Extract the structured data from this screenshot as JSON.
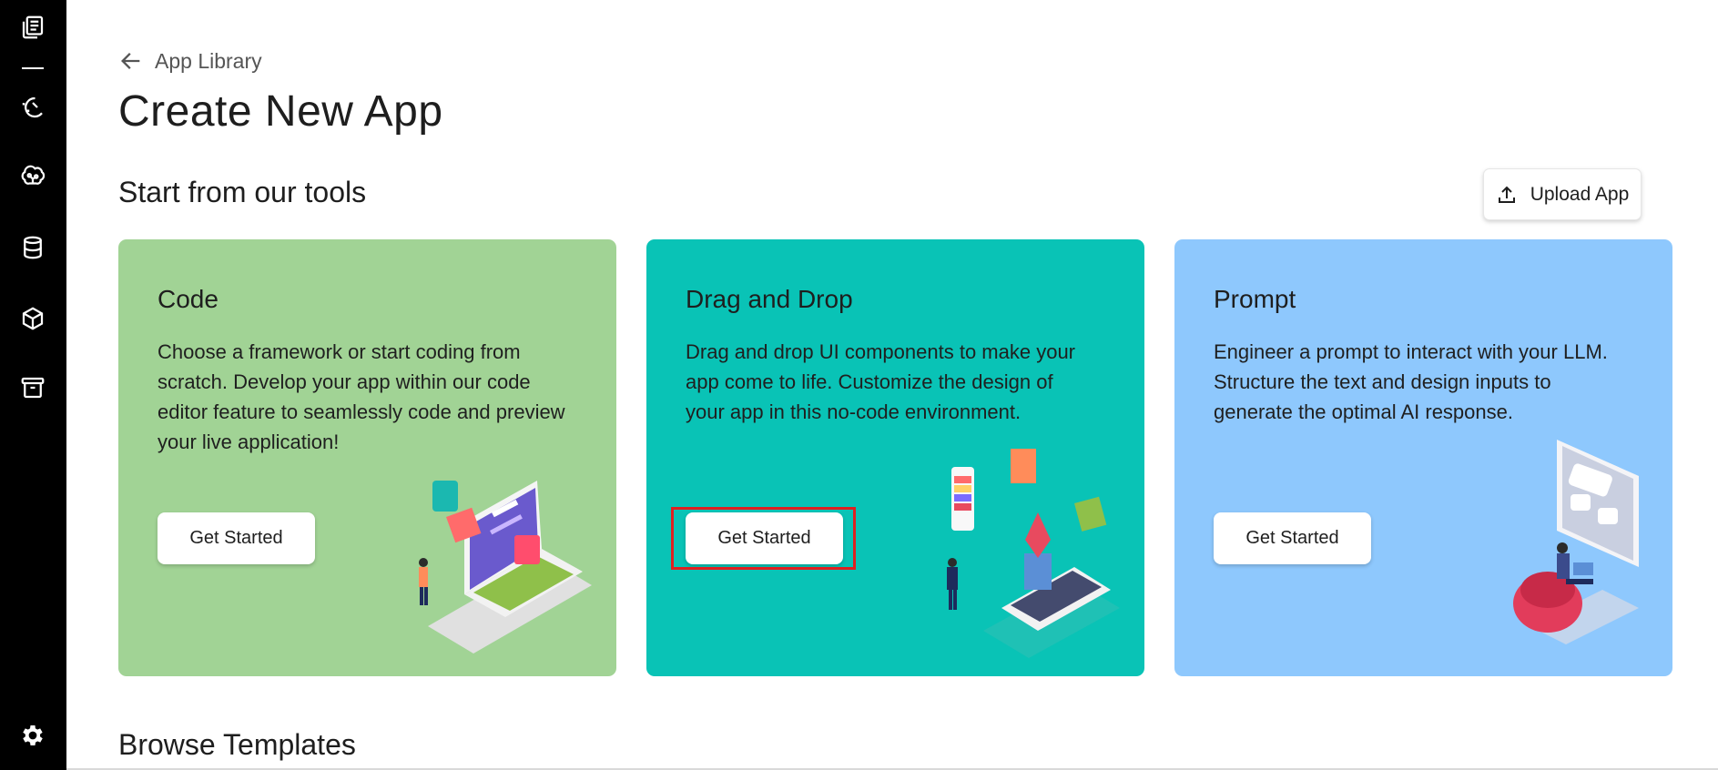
{
  "sidebar": {
    "items": [
      {
        "icon": "library-icon"
      },
      {
        "icon": "magic-icon"
      },
      {
        "icon": "brain-icon"
      },
      {
        "icon": "database-icon"
      },
      {
        "icon": "cube-icon"
      },
      {
        "icon": "archive-icon"
      },
      {
        "icon": "gear-icon"
      }
    ]
  },
  "header": {
    "back_label": "App Library",
    "title": "Create New App"
  },
  "tools": {
    "section_title": "Start from our tools",
    "upload_label": "Upload App",
    "cards": [
      {
        "title": "Code",
        "description": "Choose a framework or start coding from scratch. Develop your app within our code editor feature to seamlessly code and preview your live application!",
        "button": "Get Started",
        "color": "#a1d395"
      },
      {
        "title": "Drag and Drop",
        "description": "Drag and drop UI components to make your app come to life. Customize the design of your app in this no-code environment.",
        "button": "Get Started",
        "color": "#09c3b6"
      },
      {
        "title": "Prompt",
        "description": "Engineer a prompt to interact with your LLM. Structure the text and design inputs to generate the optimal AI response.",
        "button": "Get Started",
        "color": "#8ec8fd"
      }
    ]
  },
  "templates": {
    "section_title": "Browse Templates"
  }
}
